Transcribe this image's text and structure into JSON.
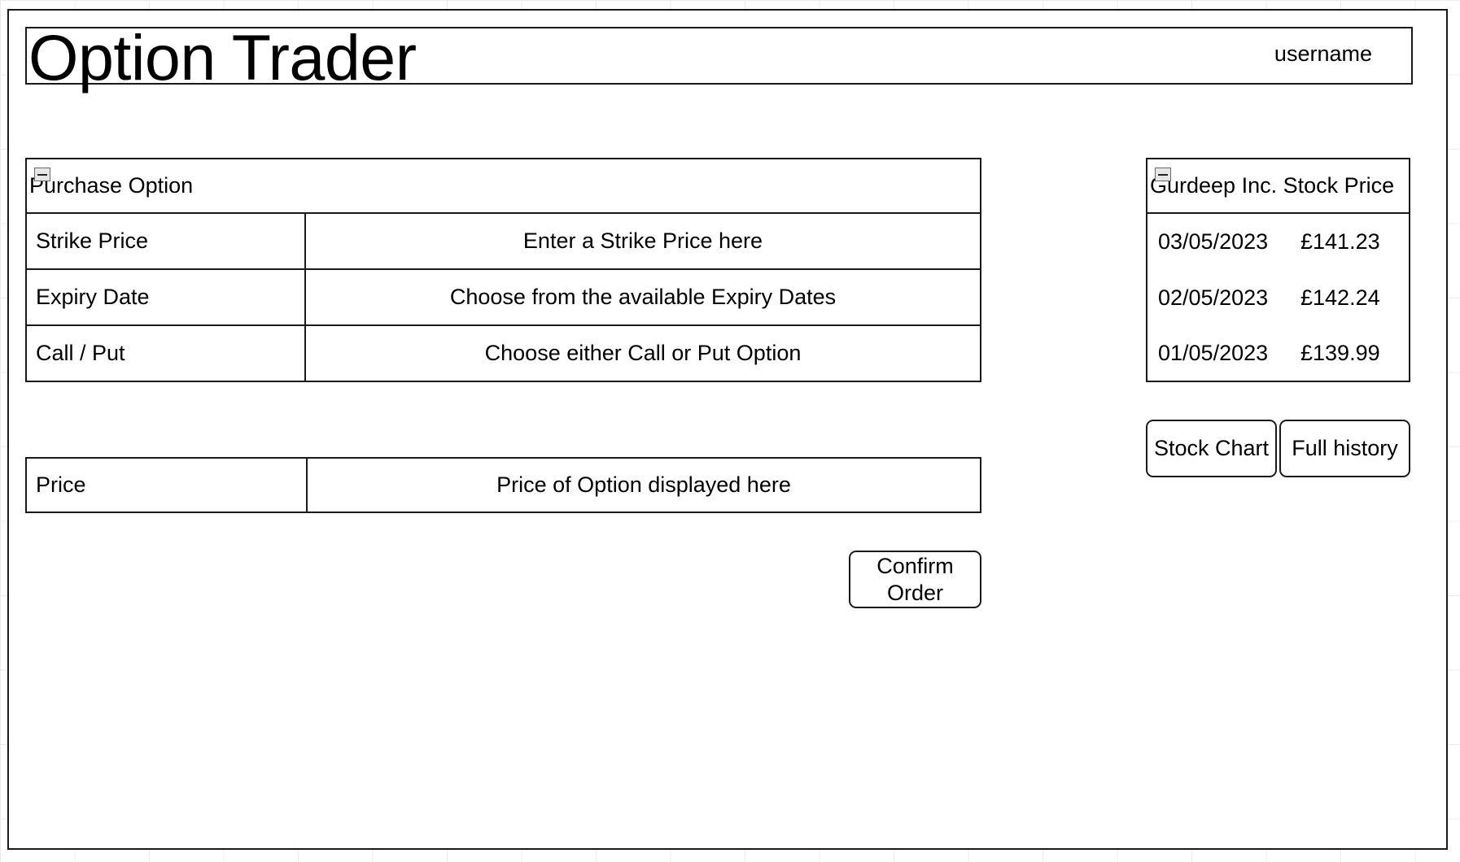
{
  "header": {
    "title": "Option Trader",
    "username": "username"
  },
  "purchase_panel": {
    "title": "Purchase Option",
    "rows": [
      {
        "label": "Strike Price",
        "value": "Enter a Strike Price here"
      },
      {
        "label": "Expiry Date",
        "value": "Choose from the available Expiry Dates"
      },
      {
        "label": "Call / Put",
        "value": "Choose either Call or Put Option"
      }
    ]
  },
  "price_panel": {
    "label": "Price",
    "value": "Price of Option displayed here"
  },
  "stock_panel": {
    "title": "Gurdeep Inc. Stock Price",
    "rows": [
      {
        "date": "03/05/2023",
        "price": "£141.23"
      },
      {
        "date": "02/05/2023",
        "price": "£142.24"
      },
      {
        "date": "01/05/2023",
        "price": "£139.99"
      }
    ]
  },
  "buttons": {
    "stock_chart": "Stock Chart",
    "full_history": "Full history",
    "confirm_order": "Confirm\nOrder"
  },
  "icons": {
    "collapse": "collapse-minus-icon"
  }
}
